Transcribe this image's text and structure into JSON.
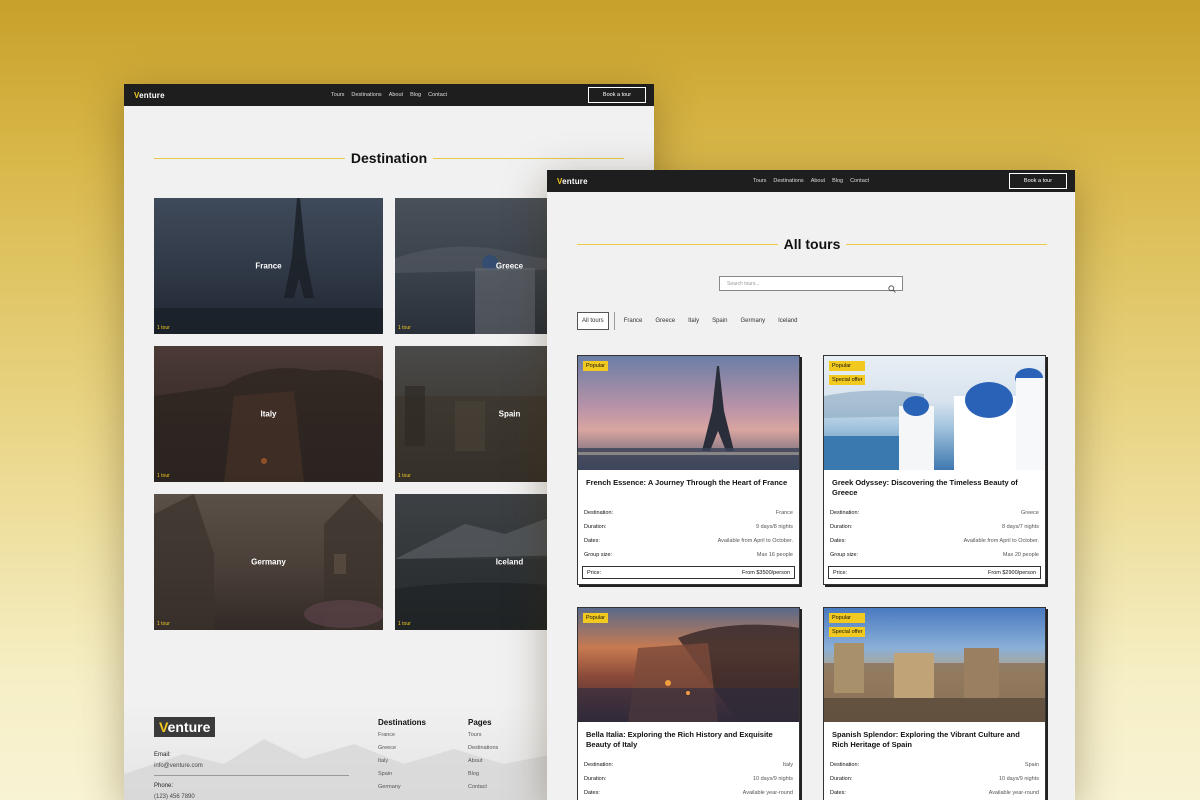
{
  "colors": {
    "accent": "#f2c91f",
    "nav_bg": "#1e1e1e",
    "page_bg": "#f1f1f1"
  },
  "brand": {
    "first_letter": "V",
    "rest": "enture"
  },
  "nav": {
    "links": [
      "Tours",
      "Destinations",
      "About",
      "Blog",
      "Contact"
    ],
    "cta": "Book a tour"
  },
  "destinations_page": {
    "title": "Destination",
    "cards": [
      {
        "name": "France",
        "count": "1 tour"
      },
      {
        "name": "Greece",
        "count": "1 tour"
      },
      {
        "name": "Italy",
        "count": "1 tour"
      },
      {
        "name": "Spain",
        "count": "1 tour"
      },
      {
        "name": "Germany",
        "count": "1 tour"
      },
      {
        "name": "Iceland",
        "count": "1 tour"
      }
    ],
    "footer": {
      "email_label": "Email:",
      "email": "info@venture.com",
      "phone_label": "Phone:",
      "phone": "(123) 456 7890",
      "col1_title": "Destinations",
      "col1_items": [
        "France",
        "Greece",
        "Italy",
        "Spain",
        "Germany"
      ],
      "col2_title": "Pages",
      "col2_items": [
        "Tours",
        "Destinations",
        "About",
        "Blog",
        "Contact"
      ]
    }
  },
  "tours_page": {
    "title": "All tours",
    "search_placeholder": "Search tours...",
    "filters": [
      "All tours",
      "France",
      "Greece",
      "Italy",
      "Spain",
      "Germany",
      "Iceland"
    ],
    "labels": {
      "destination": "Destination:",
      "duration": "Duration:",
      "dates": "Dates:",
      "group": "Group size:",
      "price": "Price:"
    },
    "tours": [
      {
        "badges": [
          "Popular"
        ],
        "title": "French Essence: A Journey Through the Heart of France",
        "destination": "France",
        "duration": "9 days/8 nights",
        "dates": "Available from April to October.",
        "group": "Max 16 people",
        "price": "From $3500/person"
      },
      {
        "badges": [
          "Popular",
          "Special offer"
        ],
        "title": "Greek Odyssey: Discovering the Timeless Beauty of Greece",
        "destination": "Greece",
        "duration": "8 days/7 nights",
        "dates": "Available from April to October.",
        "group": "Max 20 people",
        "price": "From $2900/person"
      },
      {
        "badges": [
          "Popular"
        ],
        "title": "Bella Italia: Exploring the Rich History and Exquisite Beauty of Italy",
        "destination": "Italy",
        "duration": "10 days/9 nights",
        "dates": "Available year-round",
        "group": "",
        "price": ""
      },
      {
        "badges": [
          "Popular",
          "Special offer"
        ],
        "title": "Spanish Splendor: Exploring the Vibrant Culture and Rich Heritage of Spain",
        "destination": "Spain",
        "duration": "10 days/9 nights",
        "dates": "Available year-round",
        "group": "",
        "price": ""
      }
    ]
  }
}
